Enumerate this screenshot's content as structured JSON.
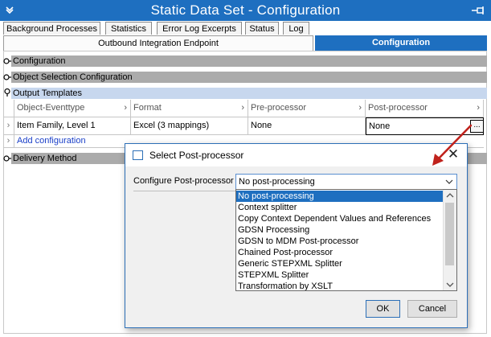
{
  "window": {
    "title": "Static Data Set - Configuration"
  },
  "tabs_row1": [
    {
      "label": "Background Processes"
    },
    {
      "label": "Statistics"
    },
    {
      "label": "Error Log Excerpts"
    },
    {
      "label": "Status"
    },
    {
      "label": "Log"
    }
  ],
  "tabs_row2": [
    {
      "label": "Outbound Integration Endpoint",
      "active": false
    },
    {
      "label": "Configuration",
      "active": true
    }
  ],
  "sections": {
    "configuration": "Configuration",
    "object_selection": "Object Selection Configuration",
    "output_templates": "Output Templates",
    "delivery_method": "Delivery Method"
  },
  "output_grid": {
    "headers": [
      "Object-Eventtype",
      "Format",
      "Pre-processor",
      "Post-processor"
    ],
    "rows": [
      {
        "object_eventtype": "Item Family, Level 1",
        "format": "Excel (3 mappings)",
        "pre_processor": "None",
        "post_processor": "None"
      }
    ],
    "add_label": "Add configuration",
    "ellipsis": "..."
  },
  "dialog": {
    "title": "Select Post-processor",
    "label": "Configure Post-processor",
    "selected_value": "No post-processing",
    "options": [
      "No post-processing",
      "Context splitter",
      "Copy Context Dependent Values and References",
      "GDSN Processing",
      "GDSN to MDM Post-processor",
      "Chained Post-processor",
      "Generic STEPXML Splitter",
      "STEPXML Splitter",
      "Transformation by XSLT"
    ],
    "ok_label": "OK",
    "cancel_label": "Cancel",
    "close_glyph": "✕"
  },
  "colors": {
    "accent": "#1e6fc0",
    "annotation_arrow": "#c0221c"
  }
}
